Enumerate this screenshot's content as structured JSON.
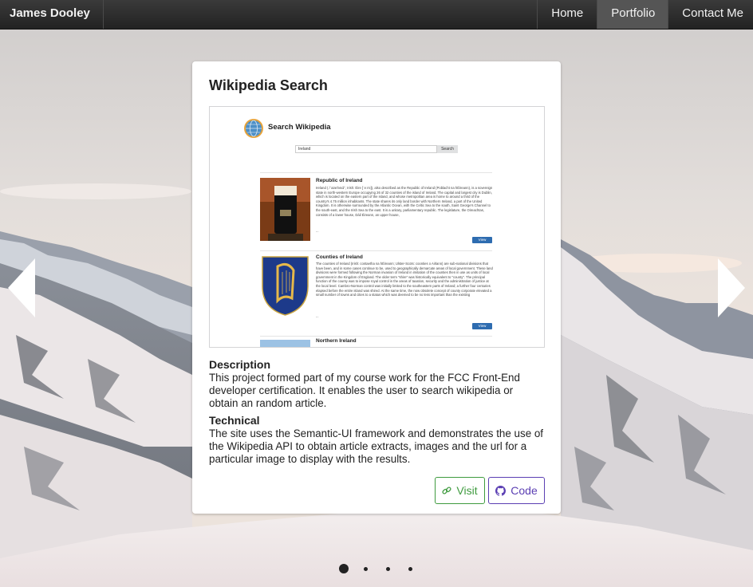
{
  "navbar": {
    "brand": "James Dooley",
    "items": [
      {
        "label": "Home",
        "active": false
      },
      {
        "label": "Portfolio",
        "active": true
      },
      {
        "label": "Contact Me",
        "active": false
      }
    ]
  },
  "card": {
    "title": "Wikipedia Search",
    "preview": {
      "title": "Search Wikipedia",
      "search_value": "Ireland",
      "search_button": "Search",
      "results": [
        {
          "title": "Republic of Ireland",
          "text": "Ireland ( /ˈaɪərlənd/ ; Irish: Éire [ˈeːɾʲə]), also described as the Republic of Ireland (Poblacht na hÉireann), is a sovereign state in north-western Europe occupying 26 of 32 counties of the island of Ireland. The capital and largest city is Dublin, which is located on the eastern part of the island, and whose metropolitan area is home to around a third of the country's 4.75 million inhabitants. The state shares its only land border with Northern Ireland, a part of the United Kingdom. It is otherwise surrounded by the Atlantic Ocean, with the Celtic Sea to the south, Saint George's Channel to the south-east, and the Irish Sea to the east. It is a unitary, parliamentary republic. The legislature, the Oireachtas, consists of a lower house, Dáil Éireann, an upper house,",
          "ellipsis": "...",
          "view": "View"
        },
        {
          "title": "Counties of Ireland",
          "text": "The counties of Ireland (Irish: contaetha na hÉireann; Ulster-Scots: coonties o Airlann) are sub-national divisions that have been, and in some cases continue to be, used to geographically demarcate areas of local government. These land divisions were formed following the Norman invasion of Ireland in imitation of the counties then in use as units of local government in the Kingdom of England. The older term \"shire\" was historically equivalent to \"county\". The principal function of the county was to impose royal control in the areas of taxation, security and the administration of justice at the local level. Cambro-Norman control was initially limited to the southeastern parts of Ireland; a further four centuries elapsed before the entire island was shired. At the same time, the now obsolete concept of county corporate elevated a small number of towns and cities to a status which was deemed to be no less important than the existing",
          "ellipsis": "...",
          "view": "View"
        },
        {
          "title": "Northern Ireland"
        }
      ]
    },
    "description_heading": "Description",
    "description": "This project formed part of my course work for the FCC Front-End developer certification. It enables the user to search wikipedia or obtain an random article.",
    "technical_heading": "Technical",
    "technical": "The site uses the Semantic-UI framework and demonstrates the use of the Wikipedia API to obtain article extracts, images and the url for a particular image to display with the results.",
    "visit_label": "Visit",
    "code_label": "Code"
  },
  "carousel": {
    "slide_count": 4,
    "active_index": 0
  },
  "colors": {
    "visit": "#3f9b3f",
    "code": "#5b3fb3",
    "navbar": "#2a2a2a"
  }
}
